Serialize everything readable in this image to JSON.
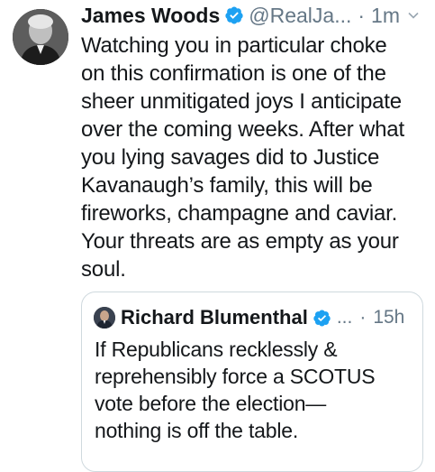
{
  "tweet": {
    "author_name": "James Woods",
    "handle": "@RealJa...",
    "separator": "·",
    "time": "1m",
    "text": "Watching you in particular choke\non this confirmation is one of the\nsheer unmitigated joys I anticipate\nover the coming weeks. After what\nyou lying savages did to Justice\nKavanaugh’s family, this will be\nfireworks, champagne and caviar.\nYour threats are as empty as your\nsoul."
  },
  "quoted_tweet": {
    "author_name": "Richard Blumenthal",
    "handle": "...",
    "separator": "·",
    "time": "15h",
    "text": "If Republicans recklessly &\nreprehensibly force a SCOTUS\nvote before the election—\nnothing is off the table."
  },
  "colors": {
    "verified_badge": "#1da1f2",
    "secondary_text": "#657786",
    "quote_border": "#cfd9de"
  },
  "icons": {
    "verified": "verified-badge-icon",
    "caret": "chevron-down-icon"
  }
}
